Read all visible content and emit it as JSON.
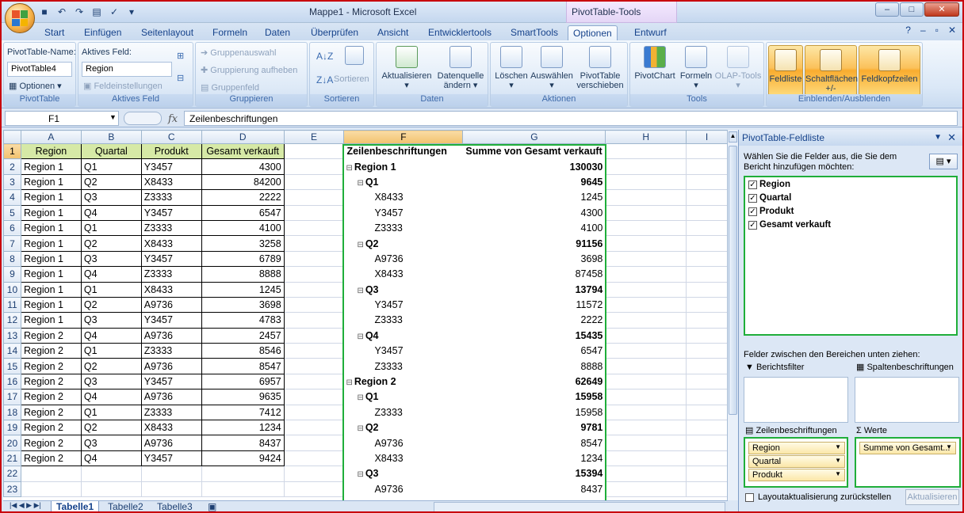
{
  "window": {
    "title": "Mappe1 - Microsoft Excel",
    "context_title": "PivotTable-Tools"
  },
  "tabs": [
    "Start",
    "Einfügen",
    "Seitenlayout",
    "Formeln",
    "Daten",
    "Überprüfen",
    "Ansicht",
    "Entwicklertools",
    "SmartTools",
    "Optionen",
    "Entwurf"
  ],
  "active_tab": "Optionen",
  "ribbon": {
    "pivottable": {
      "name_label": "PivotTable-Name:",
      "name_value": "PivotTable4",
      "options_label": "Optionen",
      "group": "PivotTable"
    },
    "aktives_feld": {
      "label": "Aktives Feld:",
      "value": "Region",
      "settings": "Feldeinstellungen",
      "group": "Aktives Feld"
    },
    "gruppieren": {
      "items": [
        "Gruppenauswahl",
        "Gruppierung aufheben",
        "Gruppenfeld"
      ],
      "group": "Gruppieren"
    },
    "sortieren": {
      "sort_label": "Sortieren",
      "group": "Sortieren"
    },
    "daten": {
      "refresh": "Aktualisieren",
      "source1": "Datenquelle",
      "source2": "ändern",
      "group": "Daten"
    },
    "aktionen": {
      "delete": "Löschen",
      "select": "Auswählen",
      "move1": "PivotTable",
      "move2": "verschieben",
      "group": "Aktionen"
    },
    "tools": {
      "chart": "PivotChart",
      "formulas": "Formeln",
      "olap": "OLAP-Tools",
      "group": "Tools"
    },
    "einblenden": {
      "fieldlist": "Feldliste",
      "buttons1": "Schaltflächen",
      "buttons2": "+/-",
      "headers": "Feldkopfzeilen",
      "group": "Einblenden/Ausblenden"
    }
  },
  "formula_bar": {
    "cell": "F1",
    "fx": "fx",
    "content": "Zeilenbeschriftungen"
  },
  "columns": [
    "A",
    "B",
    "C",
    "D",
    "E",
    "F",
    "G",
    "H",
    "I"
  ],
  "source_headers": [
    "Region",
    "Quartal",
    "Produkt",
    "Gesamt verkauft"
  ],
  "source_rows": [
    [
      "Region 1",
      "Q1",
      "Y3457",
      "4300"
    ],
    [
      "Region 1",
      "Q2",
      "X8433",
      "84200"
    ],
    [
      "Region 1",
      "Q3",
      "Z3333",
      "2222"
    ],
    [
      "Region 1",
      "Q4",
      "Y3457",
      "6547"
    ],
    [
      "Region 1",
      "Q1",
      "Z3333",
      "4100"
    ],
    [
      "Region 1",
      "Q2",
      "X8433",
      "3258"
    ],
    [
      "Region 1",
      "Q3",
      "Y3457",
      "6789"
    ],
    [
      "Region 1",
      "Q4",
      "Z3333",
      "8888"
    ],
    [
      "Region 1",
      "Q1",
      "X8433",
      "1245"
    ],
    [
      "Region 1",
      "Q2",
      "A9736",
      "3698"
    ],
    [
      "Region 1",
      "Q3",
      "Y3457",
      "4783"
    ],
    [
      "Region 2",
      "Q4",
      "A9736",
      "2457"
    ],
    [
      "Region 2",
      "Q1",
      "Z3333",
      "8546"
    ],
    [
      "Region 2",
      "Q2",
      "A9736",
      "8547"
    ],
    [
      "Region 2",
      "Q3",
      "Y3457",
      "6957"
    ],
    [
      "Region 2",
      "Q4",
      "A9736",
      "9635"
    ],
    [
      "Region 2",
      "Q1",
      "Z3333",
      "7412"
    ],
    [
      "Region 2",
      "Q2",
      "X8433",
      "1234"
    ],
    [
      "Region 2",
      "Q3",
      "A9736",
      "8437"
    ],
    [
      "Region 2",
      "Q4",
      "Y3457",
      "9424"
    ]
  ],
  "pivot": {
    "header_rows": "Zeilenbeschriftungen",
    "header_values": "Summe von Gesamt verkauft",
    "rows": [
      {
        "label": "Region 1",
        "value": "130030",
        "level": 0,
        "bold": true
      },
      {
        "label": "Q1",
        "value": "9645",
        "level": 1,
        "bold": true
      },
      {
        "label": "X8433",
        "value": "1245",
        "level": 2,
        "bold": false
      },
      {
        "label": "Y3457",
        "value": "4300",
        "level": 2,
        "bold": false
      },
      {
        "label": "Z3333",
        "value": "4100",
        "level": 2,
        "bold": false
      },
      {
        "label": "Q2",
        "value": "91156",
        "level": 1,
        "bold": true
      },
      {
        "label": "A9736",
        "value": "3698",
        "level": 2,
        "bold": false
      },
      {
        "label": "X8433",
        "value": "87458",
        "level": 2,
        "bold": false
      },
      {
        "label": "Q3",
        "value": "13794",
        "level": 1,
        "bold": true
      },
      {
        "label": "Y3457",
        "value": "11572",
        "level": 2,
        "bold": false
      },
      {
        "label": "Z3333",
        "value": "2222",
        "level": 2,
        "bold": false
      },
      {
        "label": "Q4",
        "value": "15435",
        "level": 1,
        "bold": true
      },
      {
        "label": "Y3457",
        "value": "6547",
        "level": 2,
        "bold": false
      },
      {
        "label": "Z3333",
        "value": "8888",
        "level": 2,
        "bold": false
      },
      {
        "label": "Region 2",
        "value": "62649",
        "level": 0,
        "bold": true
      },
      {
        "label": "Q1",
        "value": "15958",
        "level": 1,
        "bold": true
      },
      {
        "label": "Z3333",
        "value": "15958",
        "level": 2,
        "bold": false
      },
      {
        "label": "Q2",
        "value": "9781",
        "level": 1,
        "bold": true
      },
      {
        "label": "A9736",
        "value": "8547",
        "level": 2,
        "bold": false
      },
      {
        "label": "X8433",
        "value": "1234",
        "level": 2,
        "bold": false
      },
      {
        "label": "Q3",
        "value": "15394",
        "level": 1,
        "bold": true
      },
      {
        "label": "A9736",
        "value": "8437",
        "level": 2,
        "bold": false
      }
    ]
  },
  "row_numbers": [
    "1",
    "2",
    "3",
    "4",
    "5",
    "6",
    "7",
    "8",
    "9",
    "10",
    "11",
    "12",
    "13",
    "14",
    "15",
    "16",
    "17",
    "18",
    "19",
    "20",
    "21",
    "22",
    "23"
  ],
  "sheet_tabs": [
    "Tabelle1",
    "Tabelle2",
    "Tabelle3"
  ],
  "field_list": {
    "title": "PivotTable-Feldliste",
    "instruction": "Wählen Sie die Felder aus, die Sie dem Bericht hinzufügen möchten:",
    "fields": [
      "Region",
      "Quartal",
      "Produkt",
      "Gesamt verkauft"
    ],
    "drag_instruction": "Felder zwischen den Bereichen unten ziehen:",
    "report_filter": "Berichtsfilter",
    "column_labels": "Spaltenbeschriftungen",
    "row_labels": "Zeilenbeschriftungen",
    "values": "Werte",
    "row_fields": [
      "Region",
      "Quartal",
      "Produkt"
    ],
    "value_fields": [
      "Summe von Gesamt..."
    ],
    "defer_update": "Layoutaktualisierung zurückstellen",
    "update_button": "Aktualisieren"
  },
  "colors": {
    "highlight_green": "#1fae3a",
    "header_fill": "#d6e9a6",
    "frame_red": "#c8000c"
  }
}
